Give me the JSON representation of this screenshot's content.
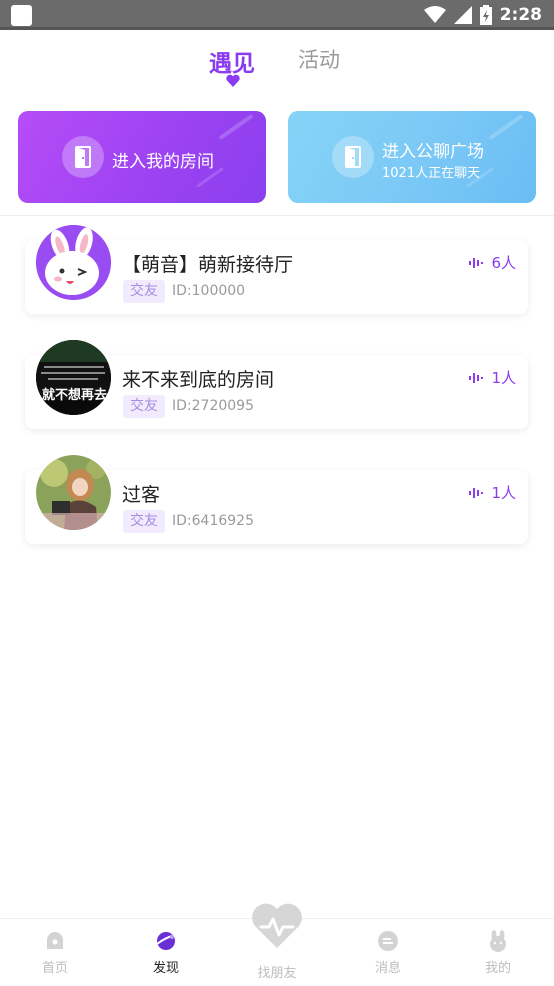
{
  "status_bar": {
    "time": "2:28"
  },
  "tabs": {
    "active": "遇见",
    "inactive": "活动"
  },
  "entries": {
    "my_room": {
      "label": "进入我的房间"
    },
    "public": {
      "label": "进入公聊广场",
      "sublabel": "1021人正在聊天"
    }
  },
  "rooms": [
    {
      "title": "【萌音】萌新接待厅",
      "tag": "交友",
      "id": "ID:100000",
      "count": "6人"
    },
    {
      "title": "来不来到底的房间",
      "tag": "交友",
      "id": "ID:2720095",
      "count": "1人",
      "avatar_text": "就不想再去"
    },
    {
      "title": "过客",
      "tag": "交友",
      "id": "ID:6416925",
      "count": "1人"
    }
  ],
  "bottom_nav": {
    "home": "首页",
    "discover": "发现",
    "find_friends": "找朋友",
    "messages": "消息",
    "mine": "我的"
  },
  "colors": {
    "accent": "#8b3cf0",
    "tag_bg": "#f1ebfd",
    "public_blue": "#7cc9f6"
  }
}
